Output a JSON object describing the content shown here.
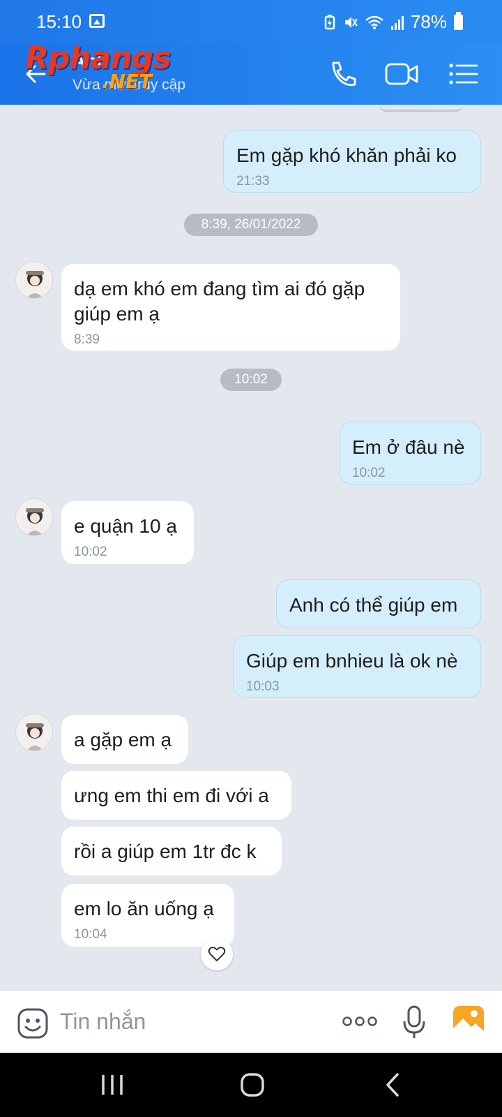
{
  "status_bar": {
    "time": "15:10",
    "battery": "78%"
  },
  "header": {
    "contact_name": "Anh",
    "status": "Vừa mới truy cập",
    "watermark_main": "Rphangs",
    "watermark_sub": ".NET"
  },
  "messages": [
    {
      "from": "me",
      "text": "Em gặp khó khăn phải ko",
      "time": "21:33"
    },
    {
      "date_divider": "8:39, 26/01/2022"
    },
    {
      "from": "them",
      "text": "dạ em khó em đang tìm ai đó gặp giúp em ạ",
      "time": "8:39"
    },
    {
      "date_divider": "10:02"
    },
    {
      "from": "me",
      "text": "Em ở đâu nè",
      "time": "10:02"
    },
    {
      "from": "them",
      "text": "e quận 10 ạ",
      "time": "10:02"
    },
    {
      "from": "me",
      "text": "Anh có thể giúp em"
    },
    {
      "from": "me",
      "text": "Giúp em bnhieu là ok nè",
      "time": "10:03"
    },
    {
      "from": "them",
      "text": "a gặp em ạ"
    },
    {
      "from": "them",
      "text": "ưng em thi em đi với a"
    },
    {
      "from": "them",
      "text": "rồi a giúp em 1tr đc k"
    },
    {
      "from": "them",
      "text": "em lo ăn uống ạ",
      "time": "10:04"
    }
  ],
  "composer": {
    "placeholder": "Tin nhắn"
  },
  "colors": {
    "accent": "#1a73e8",
    "my_bubble": "#d5eefb",
    "their_bubble": "#ffffff",
    "chat_bg": "#e3e8ef"
  },
  "icons": [
    "back-arrow-icon",
    "phone-icon",
    "video-call-icon",
    "menu-list-icon",
    "emoji-icon",
    "more-icon",
    "microphone-icon",
    "image-icon",
    "heart-icon"
  ]
}
